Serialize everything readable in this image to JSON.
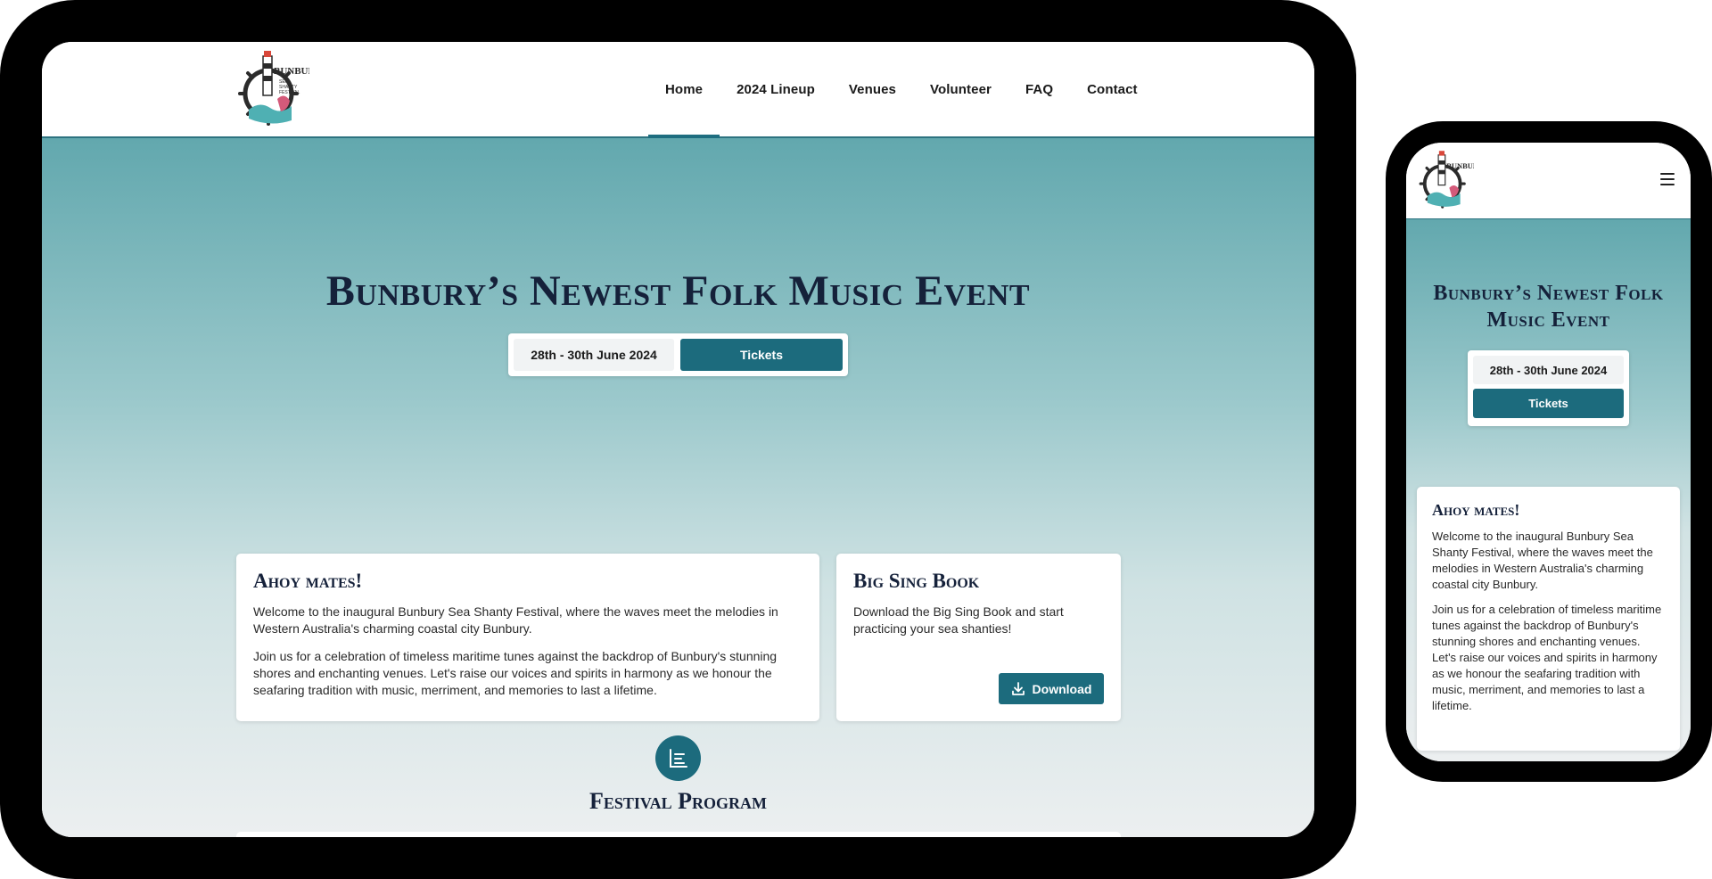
{
  "site": {
    "nav": [
      "Home",
      "2024 Lineup",
      "Venues",
      "Volunteer",
      "FAQ",
      "Contact"
    ],
    "active_nav": "Home",
    "logo_text": "BUNBURY SEA SHANTY FESTIVAL"
  },
  "hero": {
    "title": "Bunbury’s Newest Folk Music Event",
    "date": "28th - 30th June 2024",
    "tickets_label": "Tickets"
  },
  "welcome_card": {
    "title": "Ahoy mates!",
    "para1": "Welcome to the inaugural Bunbury Sea Shanty Festival, where the waves meet the melodies in Western Australia's charming coastal city Bunbury.",
    "para2": "Join us for a celebration of timeless maritime tunes against the backdrop of Bunbury's stunning shores and enchanting venues. Let's raise our voices and spirits in harmony as we honour the seafaring tradition with music, merriment, and memories to last a lifetime."
  },
  "singbook_card": {
    "title": "Big Sing Book",
    "text": "Download the Big Sing Book and start practicing your sea shanties!",
    "download_label": "Download"
  },
  "program": {
    "title": "Festival Program"
  },
  "colors": {
    "accent": "#1c6b7d",
    "title": "#15213a",
    "hero_top": "#62a8ae",
    "hero_bottom": "#eceff0"
  },
  "icons": [
    "logo-emblem",
    "download-icon",
    "program-list-icon",
    "hamburger-menu-icon"
  ]
}
